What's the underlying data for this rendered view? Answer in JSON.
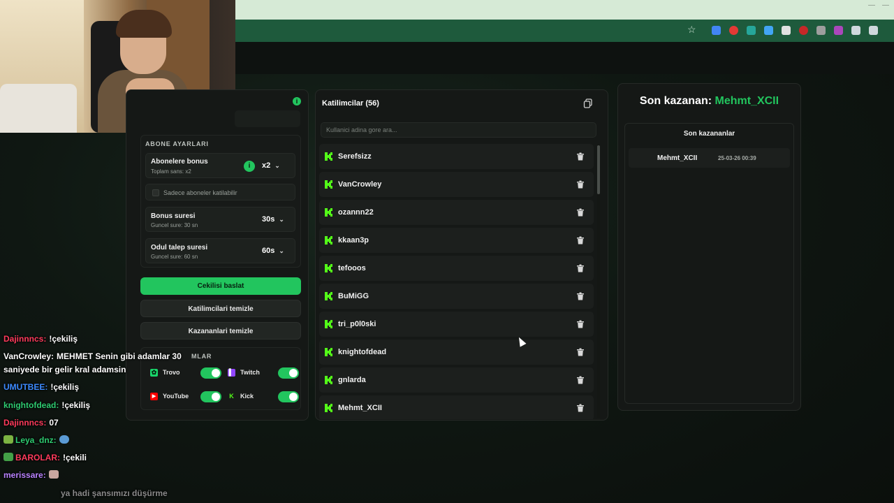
{
  "browser": {
    "extension_colors": [
      "#4285f4",
      "#e53935",
      "#26a69a",
      "#42a5f5",
      "#e0e0e0",
      "#c62828",
      "#9e9e9e",
      "#ab47bc",
      "#cfd8dc",
      "#cfd8dc"
    ]
  },
  "settings": {
    "section_title": "ABONE AYARLARI",
    "subscriber_bonus": {
      "label": "Abonelere bonus",
      "sub": "Toplam sans: x2",
      "value": "x2"
    },
    "subscribers_only": {
      "label": "Sadece aboneler katilabilir"
    },
    "bonus_duration": {
      "label": "Bonus suresi",
      "sub": "Guncel sure: 30 sn",
      "value": "30s"
    },
    "claim_duration": {
      "label": "Odul talep suresi",
      "sub": "Guncel sure: 60 sn",
      "value": "60s"
    },
    "start_button": "Cekilisi baslat",
    "clear_participants_button": "Katilimcilari temizle",
    "clear_winners_button": "Kazananlari temizle",
    "platforms_title": "MLAR",
    "platforms": [
      {
        "name": "Trovo",
        "color": "#19d66b",
        "enabled": true
      },
      {
        "name": "Twitch",
        "color": "#9146ff",
        "enabled": true
      },
      {
        "name": "YouTube",
        "color": "#ff0000",
        "enabled": true
      },
      {
        "name": "Kick",
        "color": "#53fc18",
        "enabled": true
      }
    ]
  },
  "participants": {
    "title": "Katilimcilar (56)",
    "search_placeholder": "Kullanici adina gore ara...",
    "items": [
      "Serefsizz",
      "VanCrowley",
      "ozannn22",
      "kkaan3p",
      "tefooos",
      "BuMiGG",
      "tri_p0l0ski",
      "knightofdead",
      "gnlarda",
      "Mehmt_XCII"
    ]
  },
  "winners": {
    "last_winner_prefix": "Son kazanan:",
    "last_winner_name": "Mehmt_XCII",
    "recent_title": "Son kazananlar",
    "recent": [
      {
        "name": "Mehmt_XCII",
        "date": "25-03-26 00:39"
      }
    ]
  },
  "chat": [
    {
      "user": "Dajinnncs:",
      "color": "#ff3b5c",
      "text": "!çekiliş"
    },
    {
      "user": "VanCrowley:",
      "color": "#ffffff",
      "text": "MEHMET Senin gibi adamlar 30"
    },
    {
      "user": "",
      "color": "#ffffff",
      "text": "saniyede bir gelir kral adamsin"
    },
    {
      "user": "UMUTBEE:",
      "color": "#3d8bff",
      "text": "!çekiliş"
    },
    {
      "user": "knightofdead:",
      "color": "#2ecc71",
      "text": "!çekiliş"
    },
    {
      "user": "Dajinnncs:",
      "color": "#ff3b5c",
      "text": "07"
    },
    {
      "user": "Leya_dnz:",
      "color": "#2ecc71",
      "text": ""
    },
    {
      "user": "BAROLAR:",
      "color": "#ff3b5c",
      "text": "!çekili"
    },
    {
      "user": "merissare:",
      "color": "#b983ff",
      "text": ""
    },
    {
      "user": "",
      "color": "#888888",
      "text": "ya hadi şansımızı düşürme"
    }
  ]
}
